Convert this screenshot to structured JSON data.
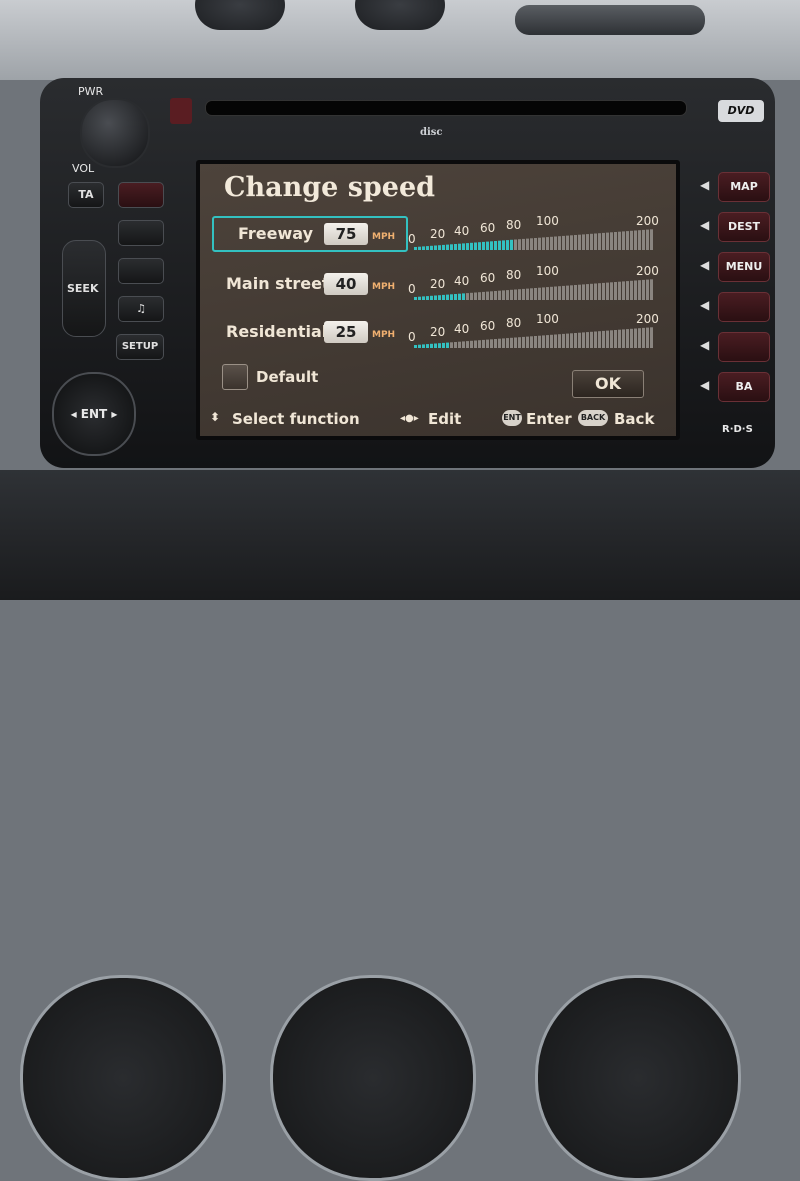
{
  "screen": {
    "title": "Change speed",
    "rows": [
      {
        "name": "Freeway",
        "value": "75",
        "unit": "MPH",
        "speed": 75,
        "focused": true
      },
      {
        "name": "Main street",
        "value": "40",
        "unit": "MPH",
        "speed": 40,
        "focused": false
      },
      {
        "name": "Residential",
        "value": "25",
        "unit": "MPH",
        "speed": 25,
        "focused": false
      }
    ],
    "gauge_ticks": [
      "0",
      "20",
      "40",
      "60",
      "80",
      "100",
      "200"
    ],
    "gauge_max": 200,
    "default_label": "Default",
    "ok_label": "OK",
    "hints": {
      "select": "Select function",
      "edit": "Edit",
      "enter": "Enter",
      "back": "Back",
      "ent_icon": "ENT",
      "back_icon": "BACK"
    },
    "accent_color": "#33c1c1"
  },
  "hardware": {
    "pwr": "PWR",
    "vol": "VOL",
    "ta": "TA",
    "seek": "SEEK",
    "ent": "◂ ENT ▸",
    "setup": "SETUP",
    "dvd": "DVD",
    "cd_logo": "disc",
    "rds": "R·D·S",
    "side_buttons": [
      "MAP",
      "DEST",
      "MENU",
      "",
      "",
      "BA"
    ]
  }
}
